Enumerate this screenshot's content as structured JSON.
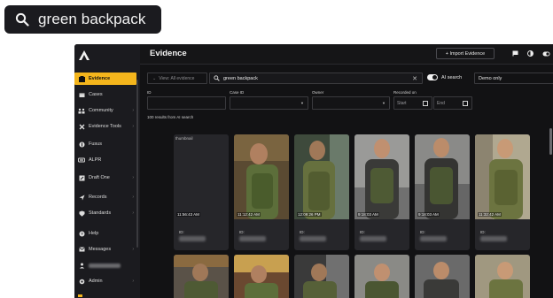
{
  "callout": {
    "query": "green backpack",
    "icon": "search-icon"
  },
  "app": {
    "title": "Evidence",
    "import_label": "+ Import Evidence",
    "sidebar": [
      {
        "label": "Evidence",
        "icon": "evidence-icon",
        "active": true
      },
      {
        "label": "Cases",
        "icon": "cases-icon"
      },
      {
        "label": "Community",
        "icon": "community-icon"
      },
      {
        "label": "Evidence Tools",
        "icon": "tools-icon"
      },
      {
        "label": "Fusus",
        "icon": "fusus-icon"
      },
      {
        "label": "ALPR",
        "icon": "alpr-icon"
      },
      {
        "label": "Draft One",
        "icon": "draft-icon"
      },
      {
        "label": "Records",
        "icon": "records-icon"
      },
      {
        "label": "Standards",
        "icon": "standards-icon"
      },
      {
        "label": "Help",
        "icon": "help-icon"
      },
      {
        "label": "Messages",
        "icon": "messages-icon"
      },
      {
        "label": "",
        "icon": "user-icon"
      },
      {
        "label": "Admin",
        "icon": "admin-icon"
      }
    ],
    "filters": {
      "view_all": "View: All evidence",
      "search_value": "green backpack",
      "ai_search_label": "AI search",
      "demo_select": "Demo only",
      "id_label": "ID",
      "case_id_label": "Case ID",
      "owner_label": "Owner",
      "recorded_label": "Recorded on",
      "start_placeholder": "Start",
      "end_placeholder": "End"
    },
    "results_text": "100 results from AI search",
    "cards": [
      {
        "time": "11:56:43 AM",
        "id_label": "ID:",
        "broken": true,
        "thumb_text": "thumbnail"
      },
      {
        "time": "11:12:42 AM",
        "id_label": "ID:"
      },
      {
        "time": "12:09:26 PM",
        "id_label": "ID:"
      },
      {
        "time": "9:18:03 AM",
        "id_label": "ID:"
      },
      {
        "time": "9:18:03 AM",
        "id_label": "ID:"
      },
      {
        "time": "11:32:42 AM",
        "id_label": "ID:"
      }
    ],
    "colors": {
      "accent": "#f4b51c",
      "bg": "#121214",
      "sidebar": "#1b1b1f"
    }
  }
}
